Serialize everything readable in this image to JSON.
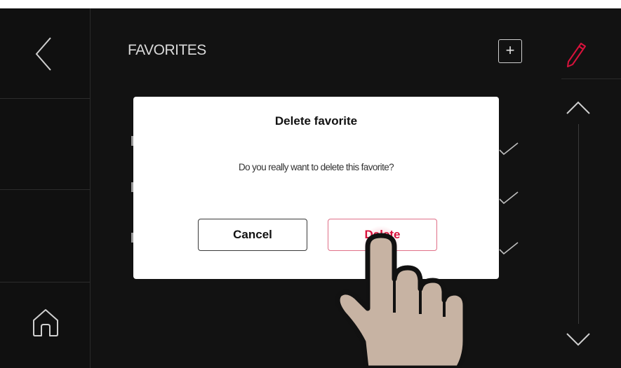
{
  "header": {
    "title": "FAVORITES"
  },
  "toolbar": {
    "add_label": "+"
  },
  "dialog": {
    "title": "Delete favorite",
    "message": "Do you really want to delete this favorite?",
    "cancel_label": "Cancel",
    "delete_label": "Delete"
  },
  "colors": {
    "background": "#121212",
    "accent_red": "#d8123c",
    "dialog_bg": "#ffffff",
    "text_light": "#d9d9d9"
  },
  "icons": {
    "back": "chevron-left-icon",
    "home": "home-icon",
    "add": "plus-square-icon",
    "edit": "pencil-icon",
    "scroll_up": "chevron-up-icon",
    "scroll_down": "chevron-down-icon",
    "list_item": "checkmark-icon",
    "pointer": "pointing-hand-icon"
  }
}
